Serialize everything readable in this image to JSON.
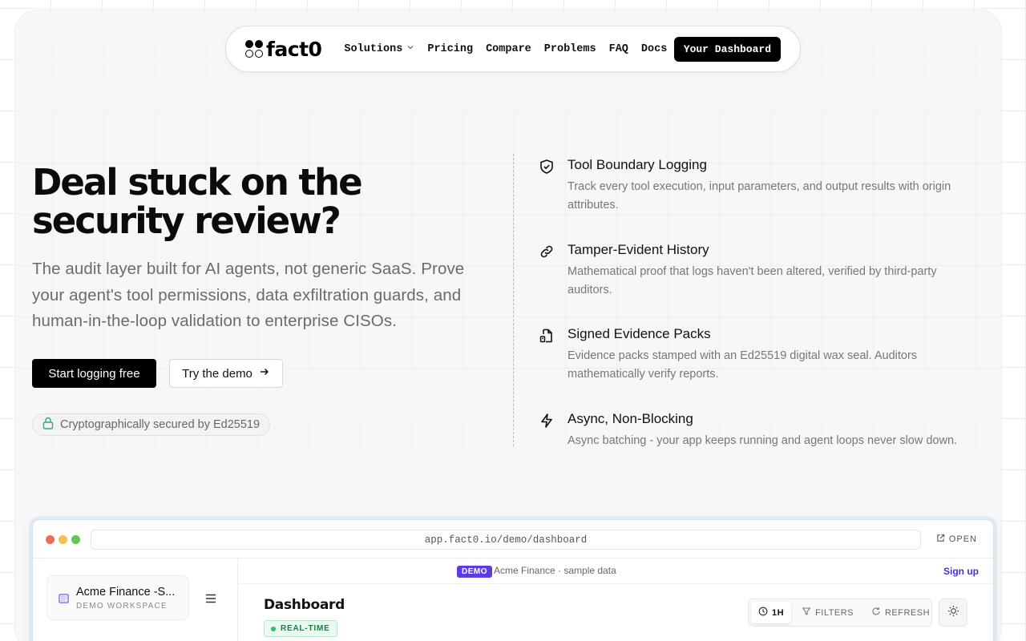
{
  "nav": {
    "logo_text": "fact0",
    "links": [
      {
        "label": "Solutions",
        "has_dropdown": true
      },
      {
        "label": "Pricing"
      },
      {
        "label": "Compare"
      },
      {
        "label": "Problems"
      },
      {
        "label": "FAQ"
      },
      {
        "label": "Docs"
      }
    ],
    "cta": "Your Dashboard"
  },
  "hero": {
    "title_line1": "Deal stuck on the",
    "title_line2": "security review?",
    "subtitle": "The audit layer built for AI agents, not generic SaaS. Prove your agent's tool permissions, data exfiltration guards, and human-in-the-loop validation to enterprise CISOs.",
    "primary_cta": "Start logging free",
    "secondary_cta": "Try the demo",
    "secure_badge": "Cryptographically secured by Ed25519"
  },
  "features": [
    {
      "icon": "shield-check-icon",
      "title": "Tool Boundary Logging",
      "desc": "Track every tool execution, input parameters, and output results with origin attributes."
    },
    {
      "icon": "link-icon",
      "title": "Tamper-Evident History",
      "desc": "Mathematical proof that logs haven't been altered, verified by third-party auditors."
    },
    {
      "icon": "file-signature-icon",
      "title": "Signed Evidence Packs",
      "desc": "Evidence packs stamped with an Ed25519 digital wax seal. Auditors mathematically verify reports."
    },
    {
      "icon": "lightning-icon",
      "title": "Async, Non-Blocking",
      "desc": "Async batching - your app keeps running and agent loops never slow down."
    }
  ],
  "demo_browser": {
    "url": "app.fact0.io/demo/dashboard",
    "open_label": "OPEN",
    "workspace_name": "Acme Finance -S...",
    "workspace_sub": "DEMO WORKSPACE",
    "demo_pill": "DEMO",
    "demo_text": "Acme Finance · sample data",
    "signup": "Sign up",
    "dashboard_title": "Dashboard",
    "realtime_label": "REAL-TIME",
    "toolbar": {
      "range": "1H",
      "filters": "FILTERS",
      "refresh": "REFRESH"
    },
    "colors": {
      "dot_red": "#ed6a5e",
      "dot_yellow": "#f5bf4f",
      "dot_green": "#62c554",
      "accent": "#5b3de0"
    }
  }
}
